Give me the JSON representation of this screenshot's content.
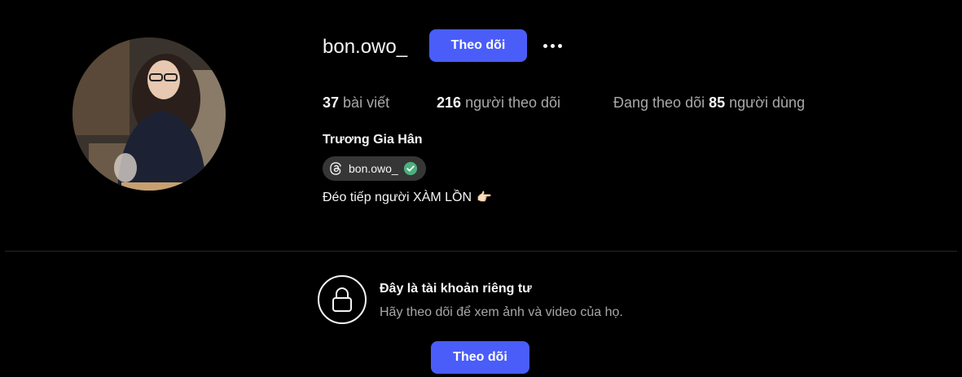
{
  "profile": {
    "username": "bon.owo_",
    "follow_label": "Theo dõi",
    "more_icon": "more-horizontal-icon",
    "stats": {
      "posts_count": "37",
      "posts_label": "bài viết",
      "followers_count": "216",
      "followers_label": "người theo dõi",
      "following_prefix": "Đang theo dõi",
      "following_count": "85",
      "following_label": "người dùng"
    },
    "full_name": "Trương Gia Hân",
    "threads_handle": "bon.owo_",
    "bio": "Đéo tiếp người XÀM LỒN",
    "bio_emoji": "👉🏻"
  },
  "private_notice": {
    "title": "Đây là tài khoản riêng tư",
    "subtitle": "Hãy theo dõi để xem ảnh và video của họ.",
    "follow_label": "Theo dõi"
  },
  "colors": {
    "background": "#000000",
    "primary_button": "#4a5df9",
    "secondary_text": "#a8a8a8",
    "badge_bg": "#363636",
    "verified_green": "#4caf7d"
  }
}
